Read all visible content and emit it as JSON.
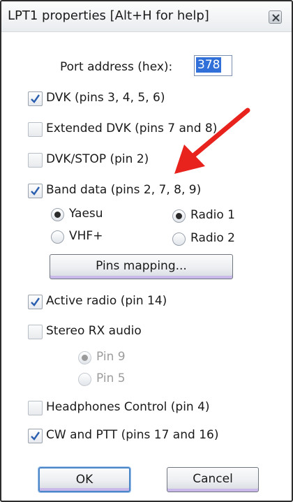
{
  "window": {
    "title": "LPT1 properties [Alt+H for help]"
  },
  "port": {
    "label": "Port address (hex):",
    "value": "378"
  },
  "options": {
    "dvk": {
      "label": "DVK (pins 3, 4, 5, 6)",
      "checked": true
    },
    "extended_dvk": {
      "label": "Extended DVK (pins 7 and 8)",
      "checked": false
    },
    "dvk_stop": {
      "label": "DVK/STOP (pin 2)",
      "checked": false
    },
    "band_data": {
      "label": "Band data (pins 2, 7, 8, 9)",
      "checked": true
    },
    "active_radio": {
      "label": "Active radio (pin 14)",
      "checked": true
    },
    "stereo_rx": {
      "label": "Stereo RX audio",
      "checked": false
    },
    "headphones": {
      "label": "Headphones Control (pin 4)",
      "checked": false
    },
    "cw_ptt": {
      "label": "CW and PTT (pins 17 and 16)",
      "checked": true
    }
  },
  "band_radios": {
    "yaesu": {
      "label": "Yaesu",
      "selected": true
    },
    "vhf": {
      "label": "VHF+",
      "selected": false
    },
    "radio1": {
      "label": "Radio 1",
      "selected": true
    },
    "radio2": {
      "label": "Radio 2",
      "selected": false
    }
  },
  "stereo_pins": {
    "pin9": {
      "label": "Pin 9",
      "selected": true,
      "enabled": false
    },
    "pin5": {
      "label": "Pin 5",
      "selected": false,
      "enabled": false
    }
  },
  "buttons": {
    "pins_mapping": "Pins mapping...",
    "ok": "OK",
    "cancel": "Cancel"
  },
  "colors": {
    "annotation_arrow": "#e8231d",
    "text_selection": "#3070d8",
    "button_accent": "#c8b9ea"
  },
  "icons": {
    "close": "close-icon",
    "check": "check-icon",
    "arrow": "annotation-arrow"
  }
}
